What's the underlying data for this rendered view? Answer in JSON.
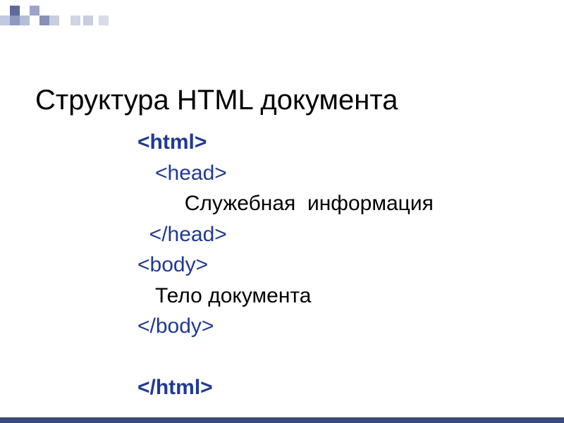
{
  "title": "Структура HTML документа",
  "code": {
    "html_open": "<html>",
    "head_open": "<head>",
    "head_content": "Служебная  информация",
    "head_close": "</head>",
    "body_open": "<body>",
    "body_content": "Тело документа",
    "body_close": "</body>",
    "html_close": "</html>"
  }
}
